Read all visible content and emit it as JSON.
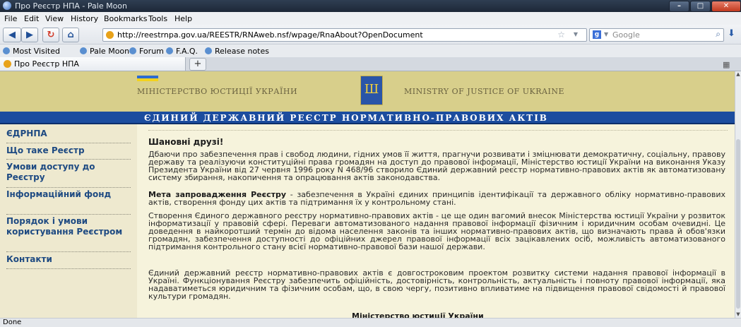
{
  "window": {
    "title": "Про Реєстр НПА - Pale Moon"
  },
  "menu": [
    "File",
    "Edit",
    "View",
    "History",
    "Bookmarks",
    "Tools",
    "Help"
  ],
  "navigation": {
    "back_icon": "back-arrow-icon",
    "forward_icon": "forward-arrow-icon",
    "reload_icon": "reload-icon",
    "home_icon": "home-icon",
    "url": "http://reestrnpa.gov.ua/REESTR/RNAweb.nsf/wpage/RnaAbout?OpenDocument",
    "search_engine": "Google"
  },
  "bookmarks": [
    "Most Visited",
    "Pale Moon",
    "Forum",
    "F.A.Q.",
    "Release notes"
  ],
  "tabs": [
    {
      "label": "Про Реєстр НПА"
    }
  ],
  "header": {
    "ministry_ua": "МІНІСТЕРСТВО ЮСТИЦІЇ УКРАЇНИ",
    "ministry_en": "MINISTRY OF JUSTICE OF UKRAINE",
    "registry_title": "ЄДИНИЙ ДЕРЖАВНИЙ РЕЄСТР НОРМАТИВНО-ПРАВОВИХ АКТІВ"
  },
  "sidebar": {
    "items": [
      {
        "label": "ЄДРНПА"
      },
      {
        "label": "Що таке Реєстр"
      },
      {
        "label": "Умови доступу до Реєстру"
      },
      {
        "label": "Інформаційний фонд"
      },
      {
        "label": "Порядок і умови користування Реєстром"
      },
      {
        "label": "Контакти"
      }
    ]
  },
  "content": {
    "greeting": "Шановні друзі!",
    "p1": "Дбаючи про забезпечення прав і свобод людини, гідних умов її життя, прагнучи розвивати і зміцнювати демократичну, соціальну, правову державу та реалізуючи конституційні права громадян на доступ до правової інформації, Міністерство юстиції України на виконання Указу Президента України від 27 червня 1996 року N 468/96 створило Єдиний державний реєстр нормативно-правових актів як автоматизовану систему збирання, накопичення та опрацювання актів законодавства.",
    "p2_bold": "Мета запровадження Реєстру",
    "p2_rest": " - забезпечення в Україні єдиних принципів ідентифікації та державного обліку нормативно-правових актів, створення фонду цих актів та підтримання їх у контрольному стані.",
    "p3": "Створення Єдиного державного реєстру нормативно-правових актів - це ще один вагомий внесок Міністерства юстиції України у розвиток інформатизації у правовій сфері. Переваги автоматизованого надання правової інформації фізичним і юридичним особам очевидні. Це доведення в найкоротший термін до відома населення законів та інших нормативно-правових актів, що визначають права й обов'язки громадян, забезпечення доступності до офіційних джерел правової інформації всіх зацікавлених осіб, можливість автоматизованого підтримання контрольного стану всієї нормативно-правової бази нашої держави.",
    "p4": "Єдиний державний реєстр нормативно-правових актів є довгостроковим проектом розвитку системи надання правової інформації в Україні. Функціонування Реєстру забезпечить офіційність, достовірність, контрольність, актуальність і повноту правової інформації, яка надаватиметься юридичним та фізичним особам, що, в свою чергу, позитивно впливатиме на підвищення правової свідомості й правової культури громадян.",
    "signature": "Міністерство юстиції України"
  },
  "status": {
    "text": "Done"
  },
  "colors": {
    "banner": "#d8cf8b",
    "registry_bar": "#1c4d9f",
    "sidebar_bg": "#eee9cf",
    "content_bg": "#f6f3dc",
    "nav_link": "#1e4a82"
  }
}
